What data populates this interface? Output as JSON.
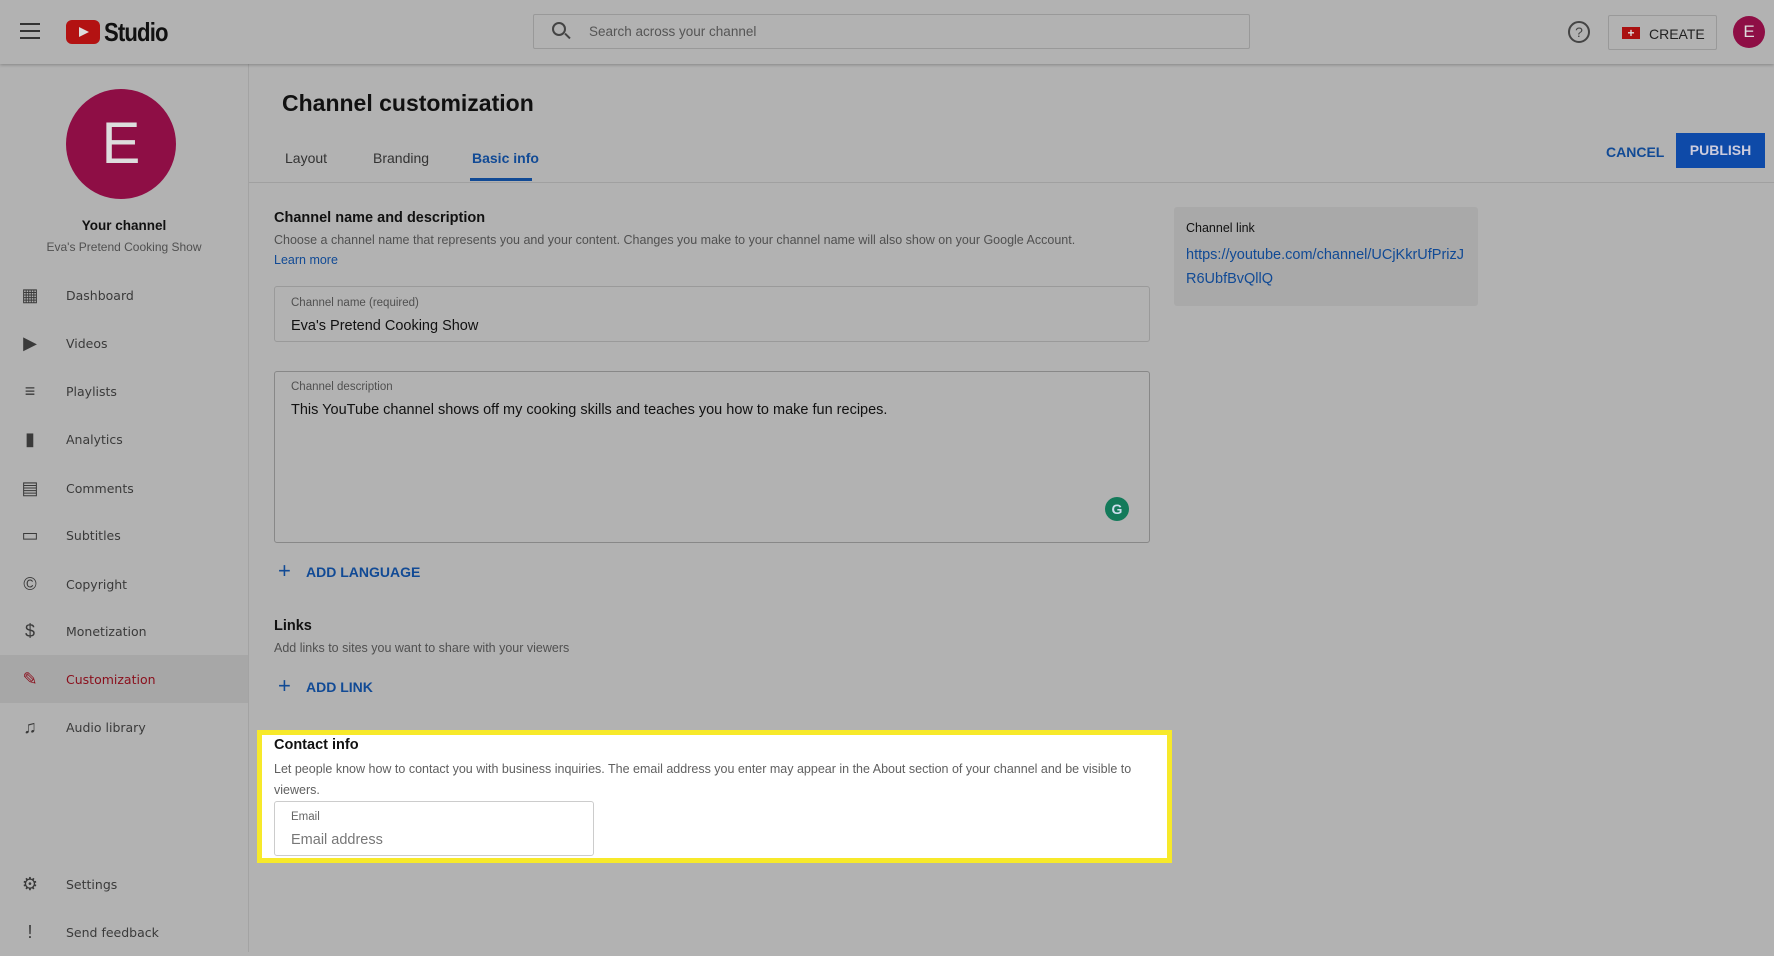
{
  "header": {
    "app_name": "Studio",
    "search_placeholder": "Search across your channel",
    "create_label": "CREATE",
    "avatar_letter": "E"
  },
  "sidebar": {
    "avatar_letter": "E",
    "channel_title": "Your channel",
    "channel_name": "Eva's Pretend Cooking Show",
    "items": [
      {
        "label": "Dashboard",
        "icon": "dashboard-icon"
      },
      {
        "label": "Videos",
        "icon": "videos-icon"
      },
      {
        "label": "Playlists",
        "icon": "playlists-icon"
      },
      {
        "label": "Analytics",
        "icon": "analytics-icon"
      },
      {
        "label": "Comments",
        "icon": "comments-icon"
      },
      {
        "label": "Subtitles",
        "icon": "subtitles-icon"
      },
      {
        "label": "Copyright",
        "icon": "copyright-icon"
      },
      {
        "label": "Monetization",
        "icon": "dollar-icon"
      },
      {
        "label": "Customization",
        "icon": "magic-wand-icon",
        "active": true
      },
      {
        "label": "Audio library",
        "icon": "audio-library-icon"
      }
    ],
    "bottom": [
      {
        "label": "Settings",
        "icon": "gear-icon"
      },
      {
        "label": "Send feedback",
        "icon": "feedback-icon"
      }
    ]
  },
  "main": {
    "title": "Channel customization",
    "tabs": [
      {
        "label": "Layout"
      },
      {
        "label": "Branding"
      },
      {
        "label": "Basic info",
        "active": true
      }
    ],
    "cancel_label": "CANCEL",
    "publish_label": "PUBLISH",
    "name_section": {
      "title": "Channel name and description",
      "description": "Choose a channel name that represents you and your content. Changes you make to your channel name will also show on your Google Account.",
      "learn_more": "Learn more",
      "name_label": "Channel name (required)",
      "name_value": "Eva's Pretend Cooking Show",
      "desc_label": "Channel description",
      "desc_value": "This YouTube channel shows off my cooking skills and teaches you how to make fun recipes.",
      "add_language": "ADD LANGUAGE"
    },
    "links_section": {
      "title": "Links",
      "description": "Add links to sites you want to share with your viewers",
      "add_link": "ADD LINK"
    },
    "contact_section": {
      "title": "Contact info",
      "description": "Let people know how to contact you with business inquiries. The email address you enter may appear in the About section of your channel and be visible to viewers.",
      "email_label": "Email",
      "email_placeholder": "Email address"
    },
    "channel_link": {
      "label": "Channel link",
      "url": "https://youtube.com/channel/UCjKkrUfPrizJR6UbfBvQllQ"
    }
  },
  "colors": {
    "highlight": "#f7e92a",
    "accent_blue": "#114a95",
    "avatar": "#8e0e45",
    "active_red": "#8a0f1c"
  }
}
